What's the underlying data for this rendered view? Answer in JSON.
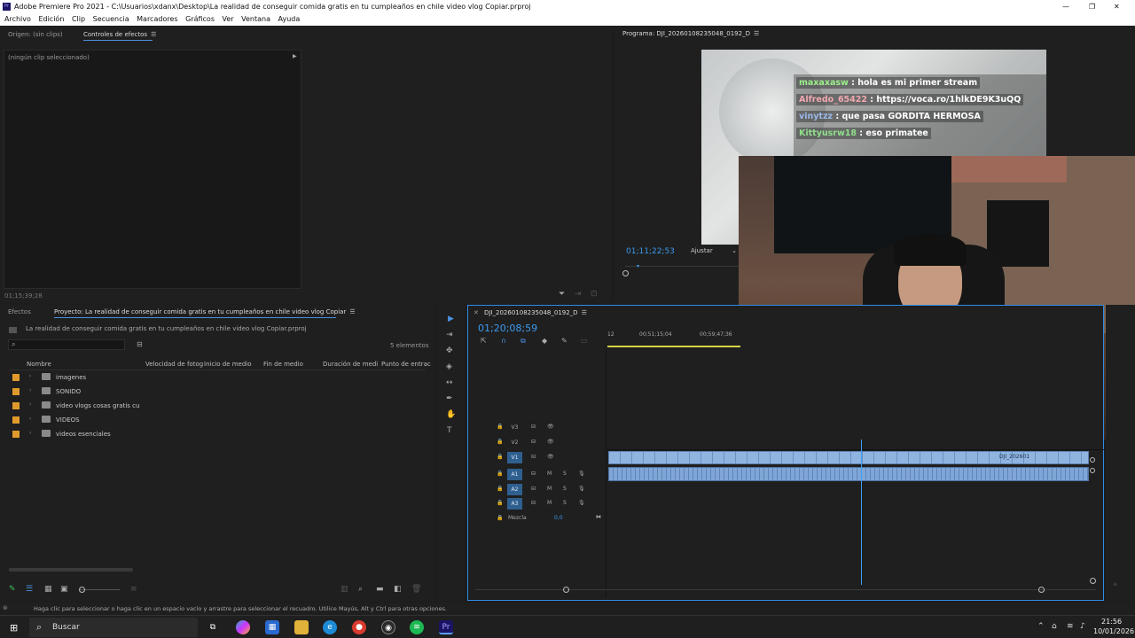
{
  "window": {
    "title": "Adobe Premiere Pro 2021 - C:\\Usuarios\\xdanx\\Desktop\\La realidad de conseguir comida gratis en tu cumpleaños en chile video vlog Copiar.prproj",
    "controls": [
      "—",
      "❐",
      "✕"
    ]
  },
  "menu": [
    "Archivo",
    "Edición",
    "Clip",
    "Secuencia",
    "Marcadores",
    "Gráficos",
    "Ver",
    "Ventana",
    "Ayuda"
  ],
  "source_panel": {
    "tab_origin": "Origen: (sin clips)",
    "tab_effects_controls": "Controles de efectos",
    "no_clip": "(ningún clip seleccionado)",
    "timecode": "01;15;39;28"
  },
  "program_panel": {
    "title": "Programa: DJI_20260108235048_0192_D",
    "timecode": "01;11;22;53",
    "fit": "Ajustar"
  },
  "chat": [
    {
      "user": "maxaxasw",
      "text": "hola es mi primer stream",
      "color": "#9bf08a"
    },
    {
      "user": "Alfredo_65422",
      "text": "https://voca.ro/1hlkDE9K3uQQ",
      "color": "#f2a8b0"
    },
    {
      "user": "vinytzz",
      "text": "que pasa GORDITA HERMOSA",
      "color": "#9bb8e8"
    },
    {
      "user": "Kittyusrw18",
      "text": "eso primatee",
      "color": "#8fe08a"
    }
  ],
  "project_panel": {
    "tab_effects": "Efectos",
    "tab_project": "Proyecto: La realidad de conseguir comida gratis en tu cumpleaños en chile video vlog Copiar",
    "file_name": "La realidad de conseguir comida gratis en tu cumpleaños en chile video vlog Copiar.prproj",
    "count": "5 elementos",
    "columns": [
      "Nombre",
      "Velocidad de fotog",
      "Inicio de medio",
      "Fin de medio",
      "Duración de medi",
      "Punto de entrac"
    ],
    "items": [
      "imagenes",
      "SONIDO",
      "video vlogs cosas gratis cu",
      "VIDEOS",
      "videos esenciales"
    ]
  },
  "timeline": {
    "sequence": "DJI_20260108235048_0192_D",
    "timecode": "01;20;08;59",
    "ruler": [
      "12",
      "00;51;15;04",
      "00;59;47;36"
    ],
    "video_tracks": [
      "V3",
      "V2",
      "V1"
    ],
    "audio_tracks": [
      "A1",
      "A2",
      "A3"
    ],
    "mix_label": "Mezcla",
    "mix_value": "0,0",
    "clip_label": "DJI_202601",
    "tools": [
      "▶",
      "⇥",
      "✥",
      "◈",
      "↔",
      "✒",
      "✋",
      "T"
    ]
  },
  "status_bar": "Haga clic para seleccionar o haga clic en un espacio vacío y arrastre para seleccionar el recuadro. Utilice Mayús, Alt y Ctrl para otras opciones.",
  "taskbar": {
    "search": "Buscar",
    "time": "21:56",
    "date": "10/01/2026"
  },
  "colors": {
    "accent_blue": "#2d8ceb",
    "clip_blue": "#8fb4e0",
    "folder": "#e09a2c",
    "playhead": "#3ca0ff"
  }
}
